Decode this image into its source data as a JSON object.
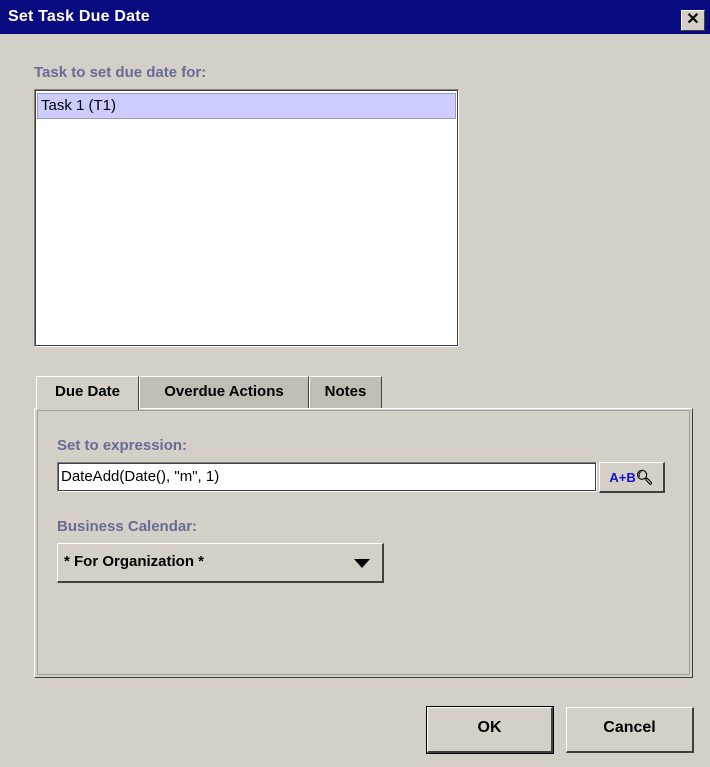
{
  "window": {
    "title": "Set Task Due Date",
    "close_glyph": "✕"
  },
  "task_section": {
    "label": "Task to set due date for:",
    "items": [
      {
        "label": "Task 1 (T1)",
        "selected": true
      }
    ]
  },
  "tabs": [
    {
      "label": "Due Date",
      "active": true
    },
    {
      "label": "Overdue Actions",
      "active": false
    },
    {
      "label": "Notes",
      "active": false
    }
  ],
  "due_date": {
    "expression_label": "Set to expression:",
    "expression_value": "DateAdd(Date(), \"m\", 1)",
    "builder_button": {
      "label": "A+B",
      "icon": "magnifier-icon",
      "icon_glyph": "🔍"
    },
    "calendar_label": "Business Calendar:",
    "calendar_value": "* For Organization *"
  },
  "buttons": {
    "ok_label": "OK",
    "cancel_label": "Cancel"
  },
  "colors": {
    "titlebar": "#0a0a80",
    "label": "#6a6a98",
    "selection": "#ccccff",
    "face": "#d4d0c8"
  }
}
